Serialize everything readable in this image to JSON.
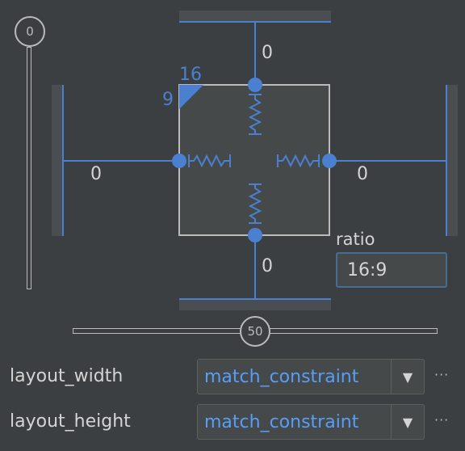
{
  "margins": {
    "top": "0",
    "bottom": "0",
    "left": "0",
    "right": "0"
  },
  "ratio_badge": {
    "width": "16",
    "height": "9"
  },
  "bias": {
    "vertical": "0",
    "horizontal": "50"
  },
  "ratio": {
    "label": "ratio",
    "value": "16:9"
  },
  "properties": [
    {
      "label": "layout_width",
      "value": "match_constraint"
    },
    {
      "label": "layout_height",
      "value": "match_constraint"
    }
  ],
  "icons": {
    "dropdown": "triangle-down-icon",
    "more": "ellipsis-icon",
    "spring": "spring-icon"
  },
  "colors": {
    "accent": "#4a80cf",
    "background": "#3c3f41",
    "text": "#d4d4d4",
    "link": "#589df6"
  }
}
